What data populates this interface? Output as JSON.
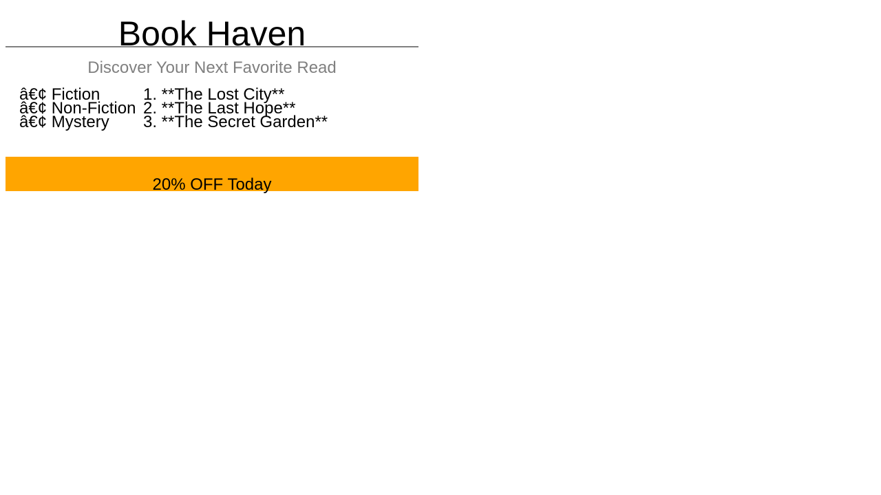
{
  "header": {
    "title": "Book Haven",
    "tagline": "Discover Your Next Favorite Read"
  },
  "categories": {
    "items": [
      {
        "label": "â€¢ Fiction"
      },
      {
        "label": "â€¢ Non-Fiction"
      },
      {
        "label": "â€¢ Mystery"
      }
    ]
  },
  "featured": {
    "items": [
      {
        "label": "1. **The Lost City**"
      },
      {
        "label": "2. **The Last Hope**"
      },
      {
        "label": "3. **The Secret Garden**"
      }
    ]
  },
  "promo": {
    "text": "20% OFF Today"
  },
  "colors": {
    "banner": "#FFA500",
    "tagline": "#808080",
    "rule": "#808080"
  }
}
